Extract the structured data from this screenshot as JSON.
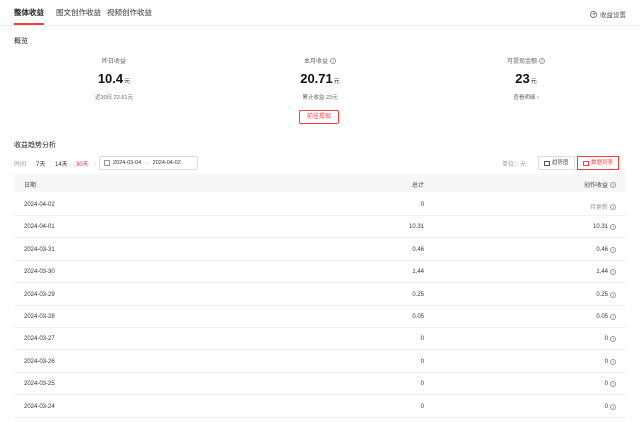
{
  "tabs": [
    {
      "label": "整体收益"
    },
    {
      "label": "图文创作收益"
    },
    {
      "label": "视频创作收益"
    }
  ],
  "settings_label": "收益设置",
  "overview": {
    "title": "概览",
    "yesterday": {
      "label": "昨日收益",
      "value": "10.4",
      "unit": "元",
      "sub": "近30日 22.61元"
    },
    "month": {
      "label": "本月收益",
      "value": "20.71",
      "unit": "元",
      "sub": "累计收益 23元"
    },
    "withdrawable": {
      "label": "可提现金额",
      "value": "23",
      "unit": "元",
      "sub": "查看明细 ›"
    },
    "withdraw_button": "前往提现"
  },
  "trend": {
    "title": "收益趋势分析",
    "time_label": "时间",
    "ranges": [
      "7天",
      "14天",
      "30天"
    ],
    "active_range": "30天",
    "date_start": "2024-03-04",
    "date_sep": "→",
    "date_end": "2024-04-02",
    "unit_label": "单位：元",
    "view_buttons": [
      {
        "label": "趋势图"
      },
      {
        "label": "数据列表"
      }
    ],
    "active_view": "数据列表"
  },
  "table": {
    "columns": [
      "日期",
      "总计",
      "创作收益"
    ],
    "rows": [
      {
        "date": "2024-04-02",
        "total": "0",
        "creation": "待更新"
      },
      {
        "date": "2024-04-01",
        "total": "10.31",
        "creation": "10.31"
      },
      {
        "date": "2024-03-31",
        "total": "0.46",
        "creation": "0.46"
      },
      {
        "date": "2024-03-30",
        "total": "1.44",
        "creation": "1.44"
      },
      {
        "date": "2024-03-29",
        "total": "0.25",
        "creation": "0.25"
      },
      {
        "date": "2024-03-28",
        "total": "0.05",
        "creation": "0.05"
      },
      {
        "date": "2024-03-27",
        "total": "0",
        "creation": "0"
      },
      {
        "date": "2024-03-26",
        "total": "0",
        "creation": "0"
      },
      {
        "date": "2024-03-25",
        "total": "0",
        "creation": "0"
      },
      {
        "date": "2024-03-24",
        "total": "0",
        "creation": "0"
      }
    ]
  },
  "colors": {
    "accent": "#f04142",
    "header_bg": "#f7f7f7"
  },
  "icons": [
    "gear-icon",
    "help-icon",
    "calendar-icon",
    "chart-icon",
    "list-icon"
  ]
}
